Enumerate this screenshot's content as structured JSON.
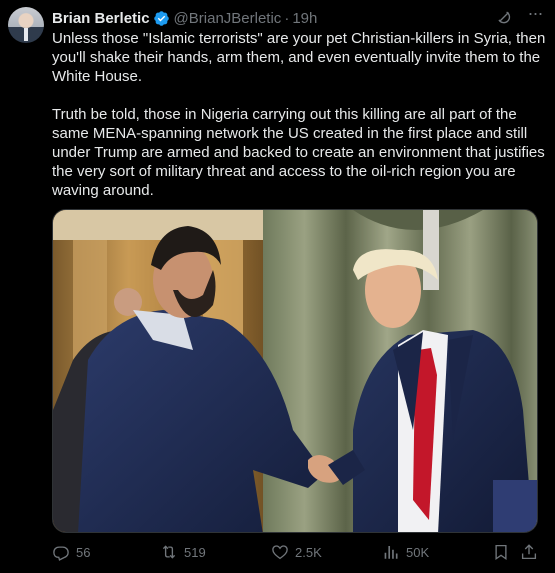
{
  "author": {
    "display_name": "Brian Berletic",
    "handle": "@BrianJBerletic",
    "separator": "·",
    "time": "19h"
  },
  "post": {
    "paragraph_1": "Unless those \"Islamic terrorists\" are your pet Christian-killers in Syria, then\nyou'll shake their hands, arm them, and even eventually invite them to the\nWhite House.",
    "paragraph_2": "Truth be told, those in Nigeria carrying out this killing are all part of the\nsame MENA-spanning network the US created in the first place and still\nunder Trump are armed and backed to create an environment that justifies\nthe very sort of military threat and access to the oil-rich region you are\nwaving around."
  },
  "actions": {
    "replies": "56",
    "reposts": "519",
    "likes": "2.5K",
    "views": "50K"
  },
  "icons": {
    "verified": "verified-badge-icon",
    "grok": "grok-icon",
    "more": "more-icon",
    "reply": "reply-icon",
    "repost": "repost-icon",
    "like": "like-icon",
    "views": "views-icon",
    "bookmark": "bookmark-icon",
    "share": "share-icon"
  },
  "colors": {
    "background": "#000000",
    "text": "#e7e9ea",
    "secondary": "#71767b",
    "verified": "#1d9bf0"
  }
}
